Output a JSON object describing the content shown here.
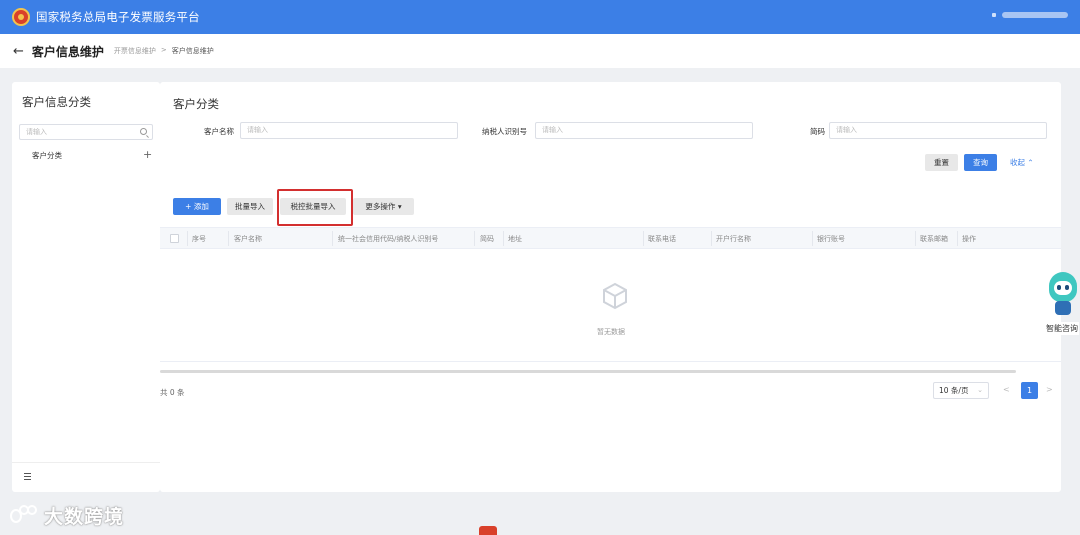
{
  "app": {
    "title": "国家税务总局电子发票服务平台"
  },
  "header": {
    "page_title": "客户信息维护",
    "breadcrumb": [
      "开票信息维护",
      "客户信息维护"
    ]
  },
  "sidebar": {
    "title": "客户信息分类",
    "search_placeholder": "请输入",
    "tree_items": [
      {
        "label": "客户分类"
      }
    ]
  },
  "main": {
    "section_title": "客户分类",
    "filters": [
      {
        "label": "客户名称",
        "placeholder": "请输入"
      },
      {
        "label": "纳税人识别号",
        "placeholder": "请输入"
      },
      {
        "label": "简码",
        "placeholder": "请输入"
      }
    ],
    "actions": {
      "reset": "重置",
      "query": "查询",
      "collapse": "收起"
    },
    "toolbar": {
      "add": "添加",
      "batch_import": "批量导入",
      "tax_batch_import": "税控批量导入",
      "more": "更多操作"
    },
    "table": {
      "columns": [
        "序号",
        "客户名称",
        "统一社会信用代码/纳税人识别号",
        "简码",
        "地址",
        "联系电话",
        "开户行名称",
        "银行账号",
        "联系邮箱",
        "操作"
      ],
      "empty_text": "暂无数据"
    },
    "pagination": {
      "total_text": "共 0 条",
      "page_size": "10 条/页",
      "current_page": "1"
    }
  },
  "assistant": {
    "label": "智能咨询"
  },
  "watermark": {
    "text": "大数跨境"
  },
  "colors": {
    "primary": "#3c7fe6",
    "highlight": "#d32f2f"
  }
}
